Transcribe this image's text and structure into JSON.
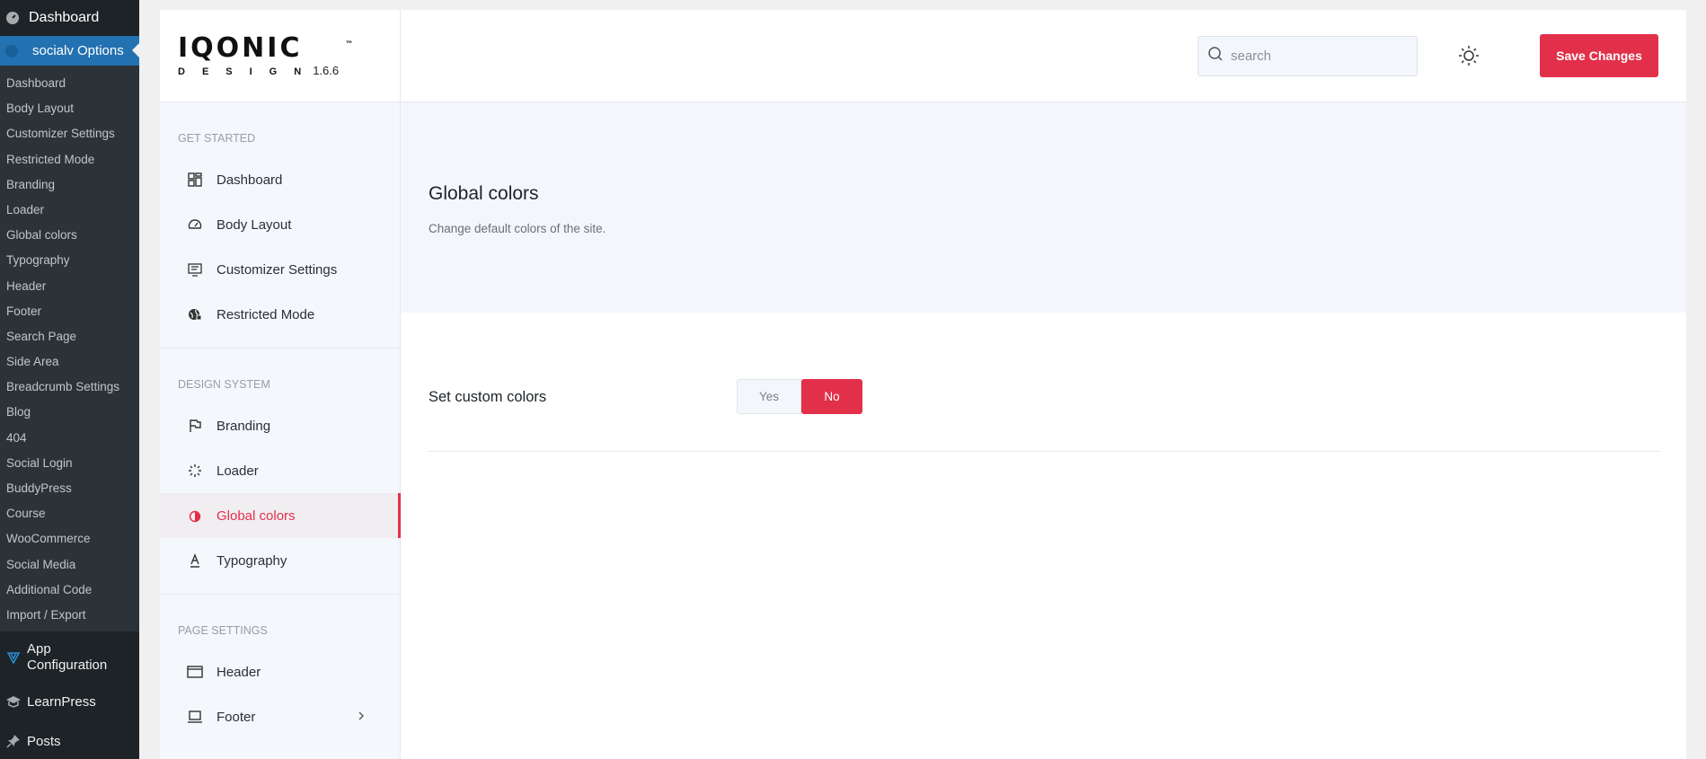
{
  "wp_admin": {
    "dashboard": "Dashboard",
    "options_menu": "socialv Options",
    "submenu": [
      "Dashboard",
      "Body Layout",
      "Customizer Settings",
      "Restricted Mode",
      "Branding",
      "Loader",
      "Global colors",
      "Typography",
      "Header",
      "Footer",
      "Search Page",
      "Side Area",
      "Breadcrumb Settings",
      "Blog",
      "404",
      "Social Login",
      "BuddyPress",
      "Course",
      "WooCommerce",
      "Social Media",
      "Additional Code",
      "Import / Export"
    ],
    "app_configuration": "App Configuration",
    "learnpress": "LearnPress",
    "posts": "Posts"
  },
  "brand": {
    "logo": "IQONIC",
    "tm": "™",
    "design": "DESIGN",
    "version": "1.6.6"
  },
  "topbar": {
    "search_placeholder": "search",
    "save_label": "Save Changes"
  },
  "nav": {
    "sections": [
      {
        "heading": "GET STARTED",
        "items": [
          "Dashboard",
          "Body Layout",
          "Customizer Settings",
          "Restricted Mode"
        ]
      },
      {
        "heading": "DESIGN SYSTEM",
        "items": [
          "Branding",
          "Loader",
          "Global colors",
          "Typography"
        ]
      },
      {
        "heading": "PAGE SETTINGS",
        "items": [
          "Header",
          "Footer"
        ]
      }
    ],
    "active": "Global colors"
  },
  "content": {
    "title": "Global colors",
    "subtitle": "Change default colors of the site.",
    "field_label": "Set custom colors",
    "yes": "Yes",
    "no": "No",
    "selected": "No"
  },
  "colors": {
    "accent": "#e3304a",
    "wp_sidebar": "#1d2327",
    "wp_active": "#2271b1"
  }
}
